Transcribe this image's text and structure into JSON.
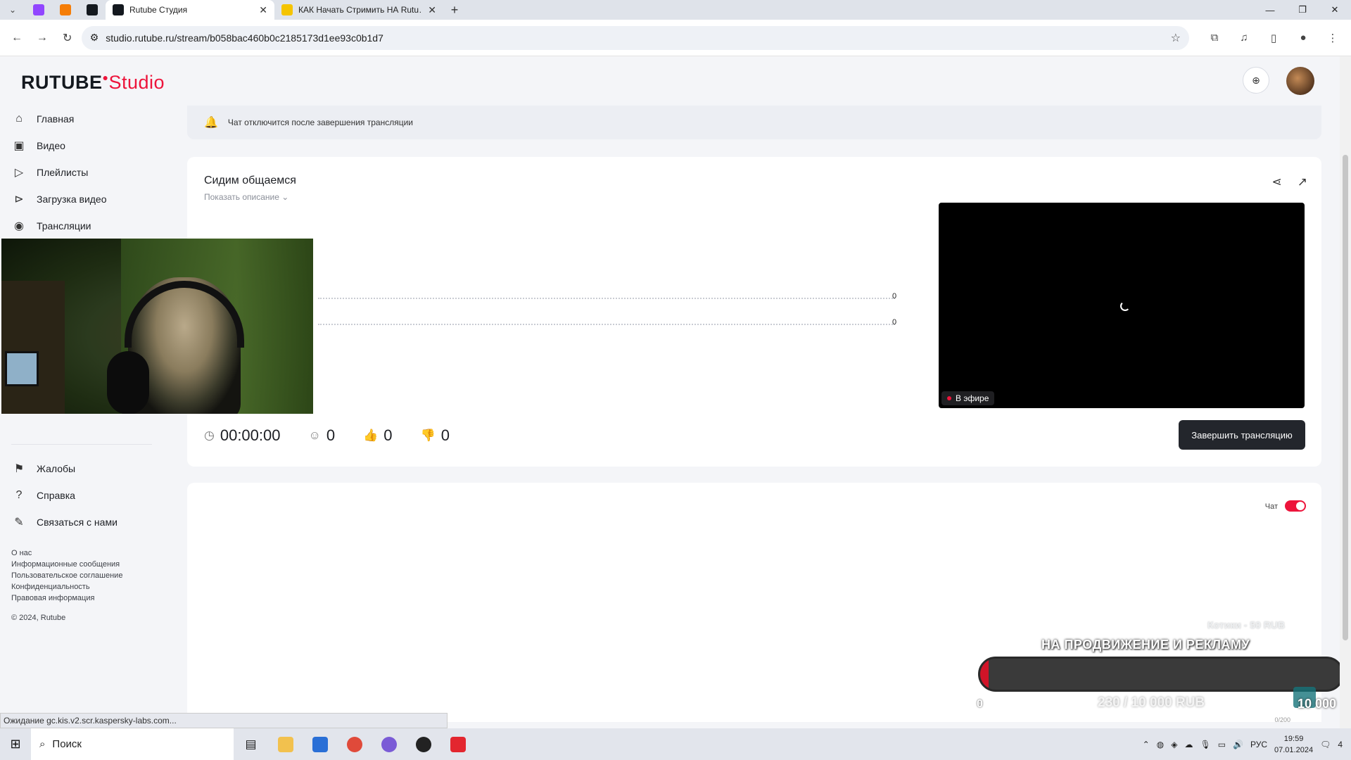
{
  "browser": {
    "tabs": [
      {
        "title": "Rutube Студия",
        "active": true
      },
      {
        "title": "КАК Начать Стримить НА Rutu…",
        "active": false
      }
    ],
    "url": "studio.rutube.ru/stream/b058bac460b0c2185173d1ee93c0b1d7",
    "status_text": "Ожидание gc.kis.v2.scr.kaspersky-labs.com..."
  },
  "header": {
    "logo_main": "RUTUBE",
    "logo_studio": "Studio"
  },
  "sidebar": {
    "top_items": [
      {
        "label": "Главная",
        "icon": "home-icon"
      },
      {
        "label": "Видео",
        "icon": "video-icon"
      },
      {
        "label": "Плейлисты",
        "icon": "playlist-icon"
      },
      {
        "label": "Загрузка видео",
        "icon": "upload-icon"
      },
      {
        "label": "Трансляции",
        "icon": "broadcast-icon"
      }
    ],
    "bottom_items": [
      {
        "label": "Жалобы",
        "icon": "flag-icon"
      },
      {
        "label": "Справка",
        "icon": "help-icon"
      },
      {
        "label": "Связаться с нами",
        "icon": "edit-icon"
      }
    ],
    "footer_links": [
      "О нас",
      "Информационные сообщения",
      "Пользовательское соглашение",
      "Конфиденциальность",
      "Правовая информация"
    ],
    "copyright": "© 2024, Rutube"
  },
  "notice": {
    "text": "Чат отключится после завершения трансляции"
  },
  "stream": {
    "title": "Сидим общаемся",
    "show_description": "Показать описание",
    "graph_value_1": "0",
    "graph_value_2": "0",
    "live_badge": "В эфире",
    "end_button": "Завершить трансляцию",
    "duration": "00:00:00",
    "viewers": "0",
    "likes": "0",
    "dislikes": "0"
  },
  "chat": {
    "label": "Чат",
    "enabled": true,
    "counter": "0/200"
  },
  "donation_overlay": {
    "small_text": "Котики - 50 RUB",
    "title": "НА ПРОДВИЖЕНИЕ И РЕКЛАМУ",
    "start": "0",
    "amount": "230 / 10 000 RUB",
    "goal": "10 000",
    "progress_fraction": 0.023,
    "fill_color": "#d11428"
  },
  "taskbar": {
    "search_label": "Поиск",
    "lang": "РУС",
    "time": "19:59",
    "date": "07.01.2024",
    "notifications": "4"
  },
  "colors": {
    "accent": "#ed143b",
    "dark_button": "#23262c"
  }
}
